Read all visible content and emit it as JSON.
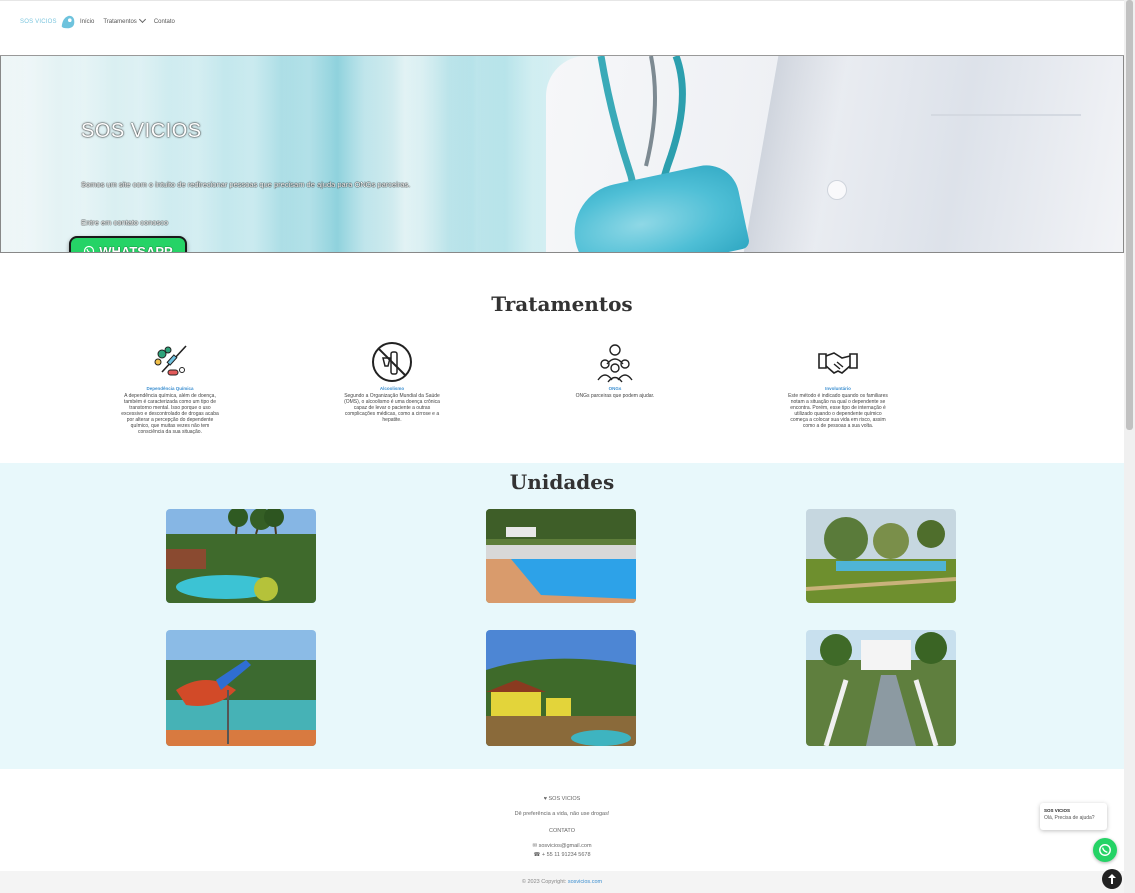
{
  "nav": {
    "logo_text": "SOS VICIOS",
    "links": [
      "Início",
      "Tratamentos",
      "Contato"
    ]
  },
  "hero": {
    "title": "SOS VICIOS",
    "description": "Somos um site com o intuito de redirecionar pessoas que precisam de ajuda para ONGs parceiras.",
    "contact_text": "Entre em contato conosco",
    "whatsapp_label": "WHATSAPP"
  },
  "tratamentos": {
    "title": "Tratamentos",
    "cards": [
      {
        "name": "Dependência Química",
        "icon": "drugs-icon",
        "text": "A dependência química, além de doença, também é caracterizada como um tipo de transtorno mental. Isso porque o uso excessivo e descontrolado de drogas acaba por alterar a percepção do dependente químico, que muitas vezes não tem consciência da sua situação."
      },
      {
        "name": "Alcoolismo",
        "icon": "no-alcohol-icon",
        "text": "Segundo a Organização Mundial da Saúde (OMS), o alcoolismo é uma doença crônica capaz de levar o paciente a outras complicações médicas, como a cirrose e a hepatite."
      },
      {
        "name": "ONGs",
        "icon": "community-icon",
        "text": "ONGs parceiras que podem ajudar."
      },
      {
        "name": "Involuntário",
        "icon": "handshake-icon",
        "text": "Este método é indicado quando os familiares notam a situação na qual o dependente se encontra. Porém, esse tipo de internação é utilizado quando o dependente químico começa a colocar sua vida em risco, assim como a de pessoas a sua volta."
      }
    ]
  },
  "unidades": {
    "title": "Unidades"
  },
  "footer": {
    "brand": "SOS VICIOS",
    "slogan": "Dê preferência a vida, não use drogas!",
    "contact_heading": "CONTATO",
    "email": "sosvicios@gmail.com",
    "phone": "+ 55 11 91234 5678",
    "copyright_prefix": "© 2023 Copyright:",
    "copyright_link": "sosvicios.com"
  },
  "chat": {
    "name": "SOS VICIOS",
    "message": "Olá, Precisa de ajuda?"
  },
  "colors": {
    "whatsapp_green": "#25d366",
    "accent_blue": "#3a8ed0",
    "units_bg": "#e8f8fb"
  }
}
